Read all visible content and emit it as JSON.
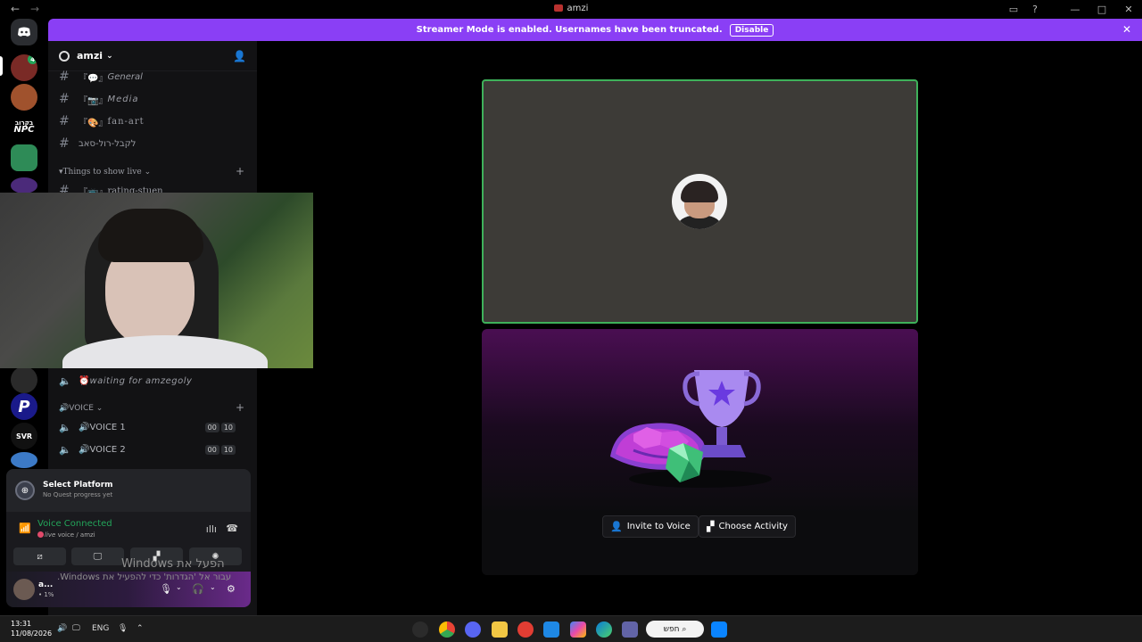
{
  "window": {
    "title": "amzi",
    "back_icon": "←",
    "forward_icon": "→"
  },
  "banner": {
    "text": "Streamer Mode is enabled. Usernames have been truncated.",
    "button": "Disable",
    "color": "#8a3ff5"
  },
  "sidebar": {
    "server_name": "amzi",
    "channels": [
      {
        "prefix": "『💬』",
        "name": "General"
      },
      {
        "prefix": "『📷』",
        "name": "Media"
      },
      {
        "prefix": "『🎨』",
        "name": "fan-art"
      },
      {
        "prefix": "",
        "name": "לקבל-רול-סאב"
      }
    ],
    "category_live": "Things to show live",
    "live_channel": {
      "prefix": "『📺』",
      "name": "rating-stuen"
    },
    "waiting_channel": {
      "prefix": "⏰",
      "name": "waiting for amzegoly"
    },
    "category_voice": "VOICE",
    "voice_channels": [
      {
        "prefix": "🔊",
        "name": "VOICE 1",
        "count_a": "00",
        "count_b": "10"
      },
      {
        "prefix": "🔊",
        "name": "VOICE 2",
        "count_a": "00",
        "count_b": "10"
      }
    ],
    "rail_badge": "4",
    "rail_label_1": "בקרוב",
    "rail_label_2": "NPC",
    "rail_label_3": "P",
    "rail_label_4": "SVR"
  },
  "quest": {
    "title": "Select Platform",
    "subtitle": "No Quest progress yet"
  },
  "voice_panel": {
    "status": "Voice Connected",
    "channel": "live",
    "channel_suffix": "voice / amzi"
  },
  "user_panel": {
    "name": "a...",
    "status": "• 1%"
  },
  "watermark": {
    "line1": "הפעל את Windows",
    "line2": "עבור אל 'הגדרות' כדי להפעיל את Windows."
  },
  "stage": {
    "invite_button": "Invite to Voice",
    "activity_button": "Choose Activity",
    "speaking_color": "#3eb15a"
  },
  "taskbar": {
    "time": "13:31",
    "date": "11/08/2026",
    "lang": "ENG",
    "search": "חפש"
  }
}
